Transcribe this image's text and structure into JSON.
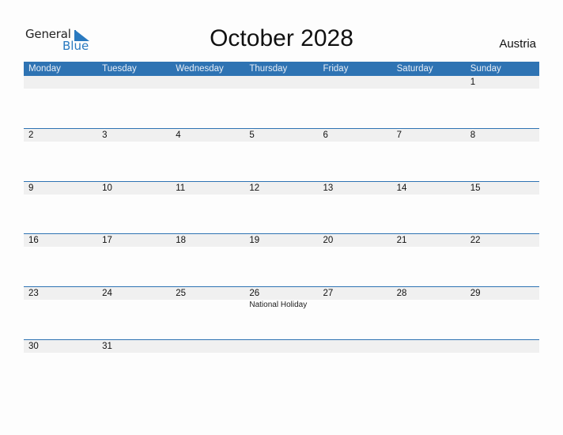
{
  "logo": {
    "word1": "General",
    "word2": "Blue"
  },
  "title": "October 2028",
  "country": "Austria",
  "colors": {
    "header_bg": "#2e73b3",
    "band_bg": "#f0f0f0",
    "logo_blue": "#2a7ac0"
  },
  "weekdays": [
    "Monday",
    "Tuesday",
    "Wednesday",
    "Thursday",
    "Friday",
    "Saturday",
    "Sunday"
  ],
  "weeks": [
    [
      {
        "day": "",
        "note": ""
      },
      {
        "day": "",
        "note": ""
      },
      {
        "day": "",
        "note": ""
      },
      {
        "day": "",
        "note": ""
      },
      {
        "day": "",
        "note": ""
      },
      {
        "day": "",
        "note": ""
      },
      {
        "day": "1",
        "note": ""
      }
    ],
    [
      {
        "day": "2",
        "note": ""
      },
      {
        "day": "3",
        "note": ""
      },
      {
        "day": "4",
        "note": ""
      },
      {
        "day": "5",
        "note": ""
      },
      {
        "day": "6",
        "note": ""
      },
      {
        "day": "7",
        "note": ""
      },
      {
        "day": "8",
        "note": ""
      }
    ],
    [
      {
        "day": "9",
        "note": ""
      },
      {
        "day": "10",
        "note": ""
      },
      {
        "day": "11",
        "note": ""
      },
      {
        "day": "12",
        "note": ""
      },
      {
        "day": "13",
        "note": ""
      },
      {
        "day": "14",
        "note": ""
      },
      {
        "day": "15",
        "note": ""
      }
    ],
    [
      {
        "day": "16",
        "note": ""
      },
      {
        "day": "17",
        "note": ""
      },
      {
        "day": "18",
        "note": ""
      },
      {
        "day": "19",
        "note": ""
      },
      {
        "day": "20",
        "note": ""
      },
      {
        "day": "21",
        "note": ""
      },
      {
        "day": "22",
        "note": ""
      }
    ],
    [
      {
        "day": "23",
        "note": ""
      },
      {
        "day": "24",
        "note": ""
      },
      {
        "day": "25",
        "note": ""
      },
      {
        "day": "26",
        "note": "National Holiday"
      },
      {
        "day": "27",
        "note": ""
      },
      {
        "day": "28",
        "note": ""
      },
      {
        "day": "29",
        "note": ""
      }
    ],
    [
      {
        "day": "30",
        "note": ""
      },
      {
        "day": "31",
        "note": ""
      },
      {
        "day": "",
        "note": ""
      },
      {
        "day": "",
        "note": ""
      },
      {
        "day": "",
        "note": ""
      },
      {
        "day": "",
        "note": ""
      },
      {
        "day": "",
        "note": ""
      }
    ]
  ]
}
